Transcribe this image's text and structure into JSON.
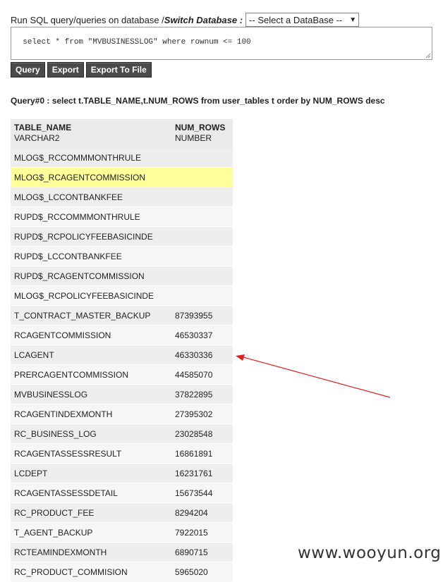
{
  "header": {
    "prefix": "Run SQL query/queries on database / ",
    "switch_label": "Switch Database :",
    "db_select_value": "-- Select a DataBase --"
  },
  "sql_input_value": "select * from \"MVBUSINESSLOG\" where rownum <= 100",
  "buttons": {
    "query": "Query",
    "export": "Export",
    "export_file": "Export To File"
  },
  "query_title": "Query#0 : select t.TABLE_NAME,t.NUM_ROWS from user_tables t order by NUM_ROWS desc",
  "result_table": {
    "columns": [
      {
        "name": "TABLE_NAME",
        "type": "VARCHAR2"
      },
      {
        "name": "NUM_ROWS",
        "type": "NUMBER"
      }
    ],
    "rows": [
      [
        "MLOG$_RCCOMMMONTHRULE",
        ""
      ],
      [
        "MLOG$_RCAGENTCOMMISSION",
        ""
      ],
      [
        "MLOG$_LCCONTBANKFEE",
        ""
      ],
      [
        "RUPD$_RCCOMMMONTHRULE",
        ""
      ],
      [
        "RUPD$_RCPOLICYFEEBASICINDE",
        ""
      ],
      [
        "RUPD$_LCCONTBANKFEE",
        ""
      ],
      [
        "RUPD$_RCAGENTCOMMISSION",
        ""
      ],
      [
        "MLOG$_RCPOLICYFEEBASICINDE",
        ""
      ],
      [
        "T_CONTRACT_MASTER_BACKUP",
        "87393955"
      ],
      [
        "RCAGENTCOMMISSION",
        "46530337"
      ],
      [
        "LCAGENT",
        "46330336"
      ],
      [
        "PRERCAGENTCOMMISSION",
        "44585070"
      ],
      [
        "MVBUSINESSLOG",
        "37822895"
      ],
      [
        "RCAGENTINDEXMONTH",
        "27395302"
      ],
      [
        "RC_BUSINESS_LOG",
        "23028548"
      ],
      [
        "RCAGENTASSESSRESULT",
        "16861891"
      ],
      [
        "LCDEPT",
        "16231761"
      ],
      [
        "RCAGENTASSESSDETAIL",
        "15673544"
      ],
      [
        "RC_PRODUCT_FEE",
        "8294204"
      ],
      [
        "T_AGENT_BACKUP",
        "7922015"
      ],
      [
        "RCTEAMINDEXMONTH",
        "6890715"
      ],
      [
        "RC_PRODUCT_COMMISION",
        "5965020"
      ]
    ],
    "highlight_color": "#ffff99"
  },
  "annotation": {
    "arrow_color": "#e02020"
  },
  "watermark": "www.wooyun.org"
}
